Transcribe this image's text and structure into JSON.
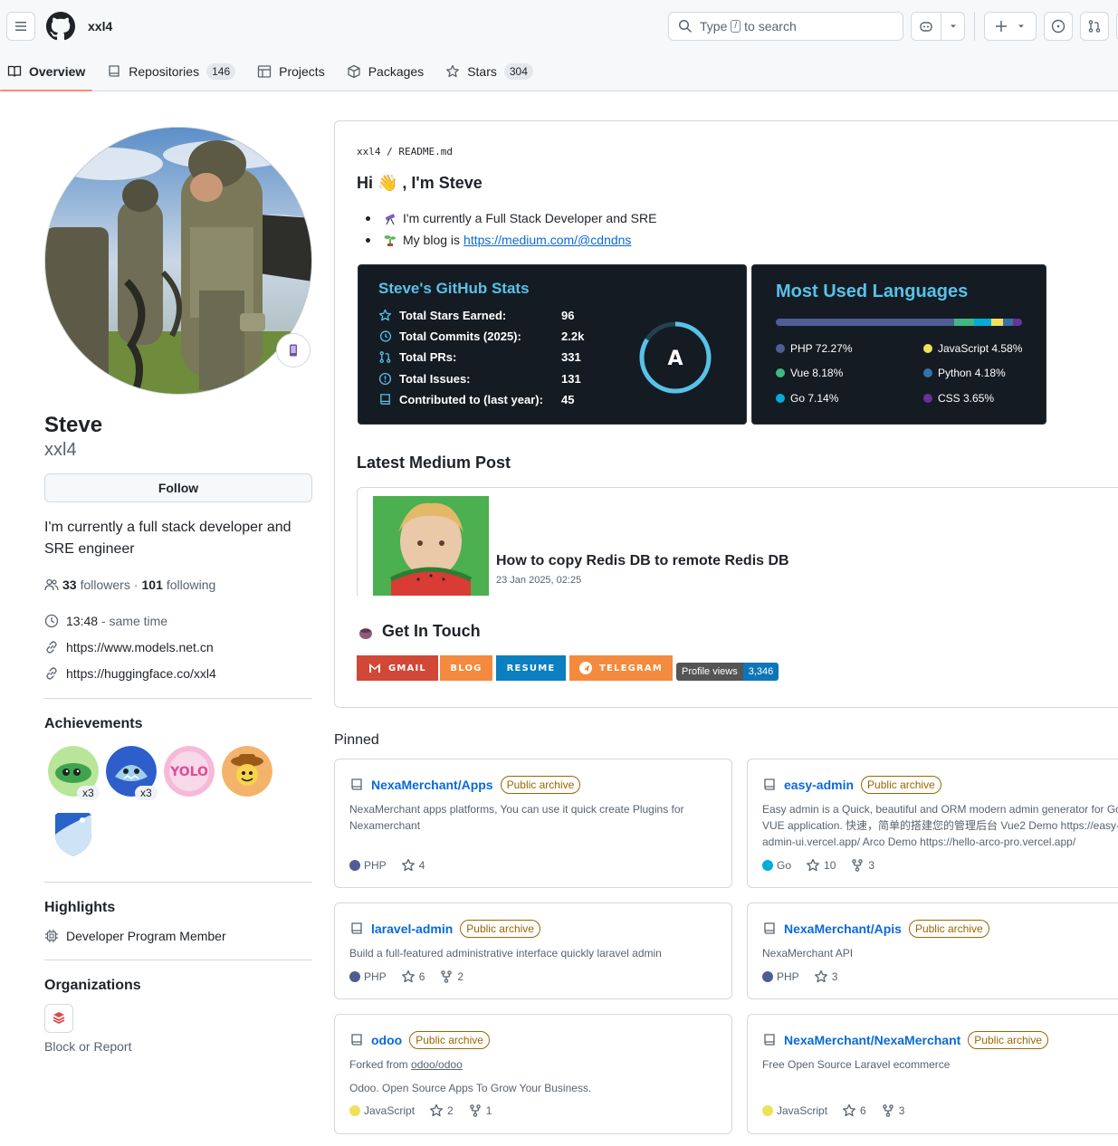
{
  "header": {
    "owner": "xxl4",
    "search_prefix": "Type",
    "search_slash": "/",
    "search_suffix": "to search"
  },
  "tabs": [
    {
      "label": "Overview",
      "active": true
    },
    {
      "label": "Repositories",
      "count": "146"
    },
    {
      "label": "Projects"
    },
    {
      "label": "Packages"
    },
    {
      "label": "Stars",
      "count": "304"
    }
  ],
  "profile": {
    "name": "Steve",
    "login": "xxl4",
    "follow_label": "Follow",
    "bio": "I'm currently a full stack developer and SRE engineer",
    "followers": "33",
    "followers_label": "followers",
    "sep": "·",
    "following": "101",
    "following_label": "following",
    "time": "13:48",
    "time_suffix": "- same time",
    "links": [
      "https://www.models.net.cn",
      "https://huggingface.co/xxl4"
    ]
  },
  "achievements": {
    "title": "Achievements",
    "multipliers": [
      "x3",
      "x3"
    ],
    "yolo_text": "YOLO"
  },
  "highlights": {
    "title": "Highlights",
    "item": "Developer Program Member"
  },
  "organizations": {
    "title": "Organizations",
    "block_report": "Block or Report"
  },
  "readme": {
    "path_owner": "xxl4",
    "path_sep": "/",
    "path_file": "README.md",
    "greeting": "Hi 👋 ,  I'm Steve",
    "line1": "I'm currently a Full Stack Developer and SRE",
    "line2_prefix": "My blog is",
    "line2_link": "https://medium.com/@cdndns",
    "stats": {
      "title": "Steve's GitHub Stats",
      "rows": [
        {
          "label": "Total Stars Earned:",
          "value": "96"
        },
        {
          "label": "Total Commits (2025):",
          "value": "2.2k"
        },
        {
          "label": "Total PRs:",
          "value": "331"
        },
        {
          "label": "Total Issues:",
          "value": "131"
        },
        {
          "label": "Contributed to (last year):",
          "value": "45"
        }
      ],
      "rank": "A"
    },
    "languages": {
      "title": "Most Used Languages",
      "items": [
        {
          "name": "PHP 72.27%",
          "color": "#4F5D95",
          "pct": 72.27
        },
        {
          "name": "Vue 8.18%",
          "color": "#41b883",
          "pct": 8.18
        },
        {
          "name": "Go 7.14%",
          "color": "#00ADD8",
          "pct": 7.14
        },
        {
          "name": "JavaScript 4.58%",
          "color": "#f1e05a",
          "pct": 4.58
        },
        {
          "name": "Python 4.18%",
          "color": "#3572A5",
          "pct": 4.18
        },
        {
          "name": "CSS 3.65%",
          "color": "#663399",
          "pct": 3.65
        }
      ]
    },
    "medium_heading": "Latest Medium Post",
    "medium_title": "How to copy Redis DB to remote Redis DB",
    "medium_date": "23 Jan 2025, 02:25",
    "contact_heading": "Get In Touch",
    "shields": [
      {
        "label": "GMAIL",
        "color": "#d14836"
      },
      {
        "label": "BLOG",
        "color": "#f48a3d"
      },
      {
        "label": "RESUME",
        "color": "#0b7fc0"
      },
      {
        "label": "TELEGRAM",
        "color": "#f48a3d"
      }
    ],
    "profile_views_label": "Profile views",
    "profile_views_count": "3,346"
  },
  "pinned": {
    "title": "Pinned",
    "archive_label": "Public archive",
    "repos": [
      {
        "name": "NexaMerchant/Apps",
        "desc": "NexaMerchant apps platforms, You can use it quick create Plugins for Nexamerchant",
        "lang": "PHP",
        "lang_color": "#4F5D95",
        "stars": "4"
      },
      {
        "name": "easy-admin",
        "desc": "Easy admin is a Quick, beautiful and ORM modern admin generator for Go VUE application. 快速，简单的搭建您的管理后台 Vue2 Demo https://easy-admin-ui.vercel.app/ Arco Demo https://hello-arco-pro.vercel.app/",
        "lang": "Go",
        "lang_color": "#00ADD8",
        "stars": "10",
        "forks": "3"
      },
      {
        "name": "laravel-admin",
        "desc": "Build a full-featured administrative interface quickly laravel admin",
        "lang": "PHP",
        "lang_color": "#4F5D95",
        "stars": "6",
        "forks": "2"
      },
      {
        "name": "NexaMerchant/Apis",
        "desc": "NexaMerchant API",
        "lang": "PHP",
        "lang_color": "#4F5D95",
        "stars": "3"
      },
      {
        "name": "odoo",
        "forked_prefix": "Forked from",
        "forked_from": "odoo/odoo",
        "desc": "Odoo. Open Source Apps To Grow Your Business.",
        "lang": "JavaScript",
        "lang_color": "#f1e05a",
        "stars": "2",
        "forks": "1"
      },
      {
        "name": "NexaMerchant/NexaMerchant",
        "desc": "Free Open Source Laravel ecommerce",
        "lang": "JavaScript",
        "lang_color": "#f1e05a",
        "stars": "6",
        "forks": "3"
      }
    ]
  }
}
